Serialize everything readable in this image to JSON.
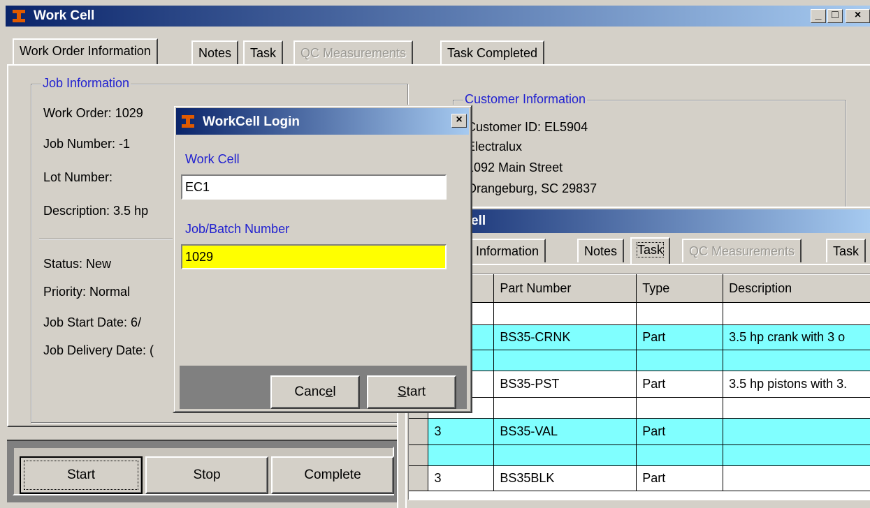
{
  "main_window": {
    "title": "Work Cell",
    "controls": {
      "minimize": "_",
      "maximize": "□",
      "close": "×"
    },
    "tabs": [
      {
        "label": "Work Order Information",
        "enabled": true
      },
      {
        "label": "Notes",
        "enabled": true
      },
      {
        "label": "Task",
        "enabled": true
      },
      {
        "label": "QC Measurements",
        "enabled": false
      },
      {
        "label": "Task Completed",
        "enabled": true
      }
    ],
    "job_info": {
      "title": "Job Information",
      "work_order": "Work Order: 1029",
      "job_number": "Job Number: -1",
      "lot_number": "Lot Number:",
      "description": "Description: 3.5 hp",
      "status": "Status: New",
      "priority": "Priority: Normal",
      "start_date": "Job Start Date:   6/",
      "delivery_date": "Job Delivery Date: (",
      "status_color": "#000000"
    },
    "customer_info": {
      "title": "Customer Information",
      "customer_id": "Customer ID: EL5904",
      "name": "Electralux",
      "street": "1092 Main Street",
      "city": "Orangeburg, SC 29837"
    },
    "buttons": {
      "start": "Start",
      "stop": "Stop",
      "complete": "Complete"
    }
  },
  "second_window": {
    "title": "ell",
    "tabs": [
      {
        "label": "er Information",
        "enabled": true
      },
      {
        "label": "Notes",
        "enabled": true
      },
      {
        "label": "Task",
        "enabled": true
      },
      {
        "label": "QC Measurements",
        "enabled": false
      },
      {
        "label": "Task",
        "enabled": true
      }
    ],
    "table": {
      "headers": [
        "",
        "Part Number",
        "Type",
        "Description"
      ],
      "rows": [
        {
          "qty": "",
          "part": "BS35-CRNK",
          "type": "Part",
          "desc": "3.5 hp crank with 3 o"
        },
        {
          "qty": "",
          "part": "BS35-PST",
          "type": "Part",
          "desc": "3.5 hp pistons with 3."
        },
        {
          "qty": "3",
          "part": "BS35-VAL",
          "type": "Part",
          "desc": ""
        },
        {
          "qty": "3",
          "part": "BS35BLK",
          "type": "Part",
          "desc": ""
        }
      ]
    },
    "row_highlight_color": "#80ffff"
  },
  "login_dialog": {
    "title": "WorkCell Login",
    "close": "×",
    "work_cell_label": "Work Cell",
    "work_cell_value": "EC1",
    "job_label": "Job/Batch Number",
    "job_value": "1029",
    "job_field_color": "#ffff00",
    "cancel_pre": "Canc",
    "cancel_u": "e",
    "cancel_post": "l",
    "start_u": "S",
    "start_post": "tart"
  },
  "colors": {
    "titlebar_start": "#0a246a",
    "titlebar_end": "#a6caf0",
    "group_title": "#1f1fd0"
  }
}
